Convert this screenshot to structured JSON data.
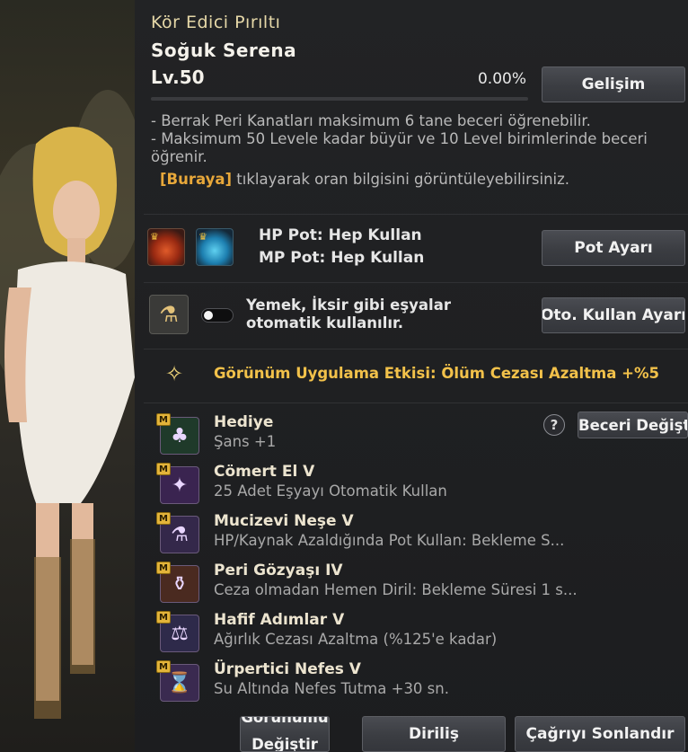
{
  "header": {
    "subtitle": "Kör Edici Pırıltı",
    "name": "Soğuk Serena",
    "level": "Lv.50",
    "progress_text": "0.00%",
    "progress": 0.0,
    "growth_button": "Gelişim"
  },
  "info": {
    "line1": "- Berrak Peri Kanatları maksimum 6 tane beceri öğrenebilir.",
    "line2": "- Maksimum 50 Levele kadar büyür ve 10 Level birimlerinde beceri öğrenir.",
    "link_text": "[Buraya]",
    "link_suffix": " tıklayarak oran bilgisini görüntüleyebilirsiniz."
  },
  "potions": {
    "hp_text": "HP Pot: Hep Kullan",
    "mp_text": "MP Pot: Hep Kullan",
    "settings_button": "Pot Ayarı"
  },
  "auto_use": {
    "text_line1": "Yemek, İksir gibi eşyalar",
    "text_line2": "otomatik kullanılır.",
    "settings_button": "Oto. Kullan Ayarı",
    "enabled": false
  },
  "appearance_effect": {
    "text": "Görünüm Uygulama Etkisi: Ölüm Cezası Azaltma +%5"
  },
  "skills_section": {
    "change_button": "Beceri Değiştir",
    "help_icon": "question-icon"
  },
  "skills": [
    {
      "name": "Hediye",
      "desc": "Şans +1",
      "icon": "clover-icon",
      "icon_color": "#1f3a2a",
      "glyph": "♣"
    },
    {
      "name": "Cömert El V",
      "desc": "25 Adet Eşyayı Otomatik Kullan",
      "icon": "fairy-icon",
      "icon_color": "#3a2450",
      "glyph": "✦"
    },
    {
      "name": "Mucizevi Neşe V",
      "desc": "HP/Kaynak Azaldığında Pot Kullan: Bekleme S...",
      "icon": "potions-icon",
      "icon_color": "#34284a",
      "glyph": "⚗"
    },
    {
      "name": "Peri Gözyaşı IV",
      "desc": "Ceza olmadan Hemen Diril: Bekleme Süresi 1 s...",
      "icon": "tear-bottle-icon",
      "icon_color": "#4a2a20",
      "glyph": "⚱"
    },
    {
      "name": "Hafif Adımlar V",
      "desc": "Ağırlık Cezası Azaltma (%125'e kadar)",
      "icon": "weight-icon",
      "icon_color": "#2e2a4a",
      "glyph": "⚖"
    },
    {
      "name": "Ürpertici Nefes V",
      "desc": "Su Altında Nefes Tutma +30 sn.",
      "icon": "breath-timer-icon",
      "icon_color": "#3a2a50",
      "glyph": "⌛"
    }
  ],
  "footer": {
    "appearance_button": "Görünümü Değiştir",
    "revive_button": "Diriliş",
    "dismiss_button": "Çağrıyı Sonlandır"
  }
}
